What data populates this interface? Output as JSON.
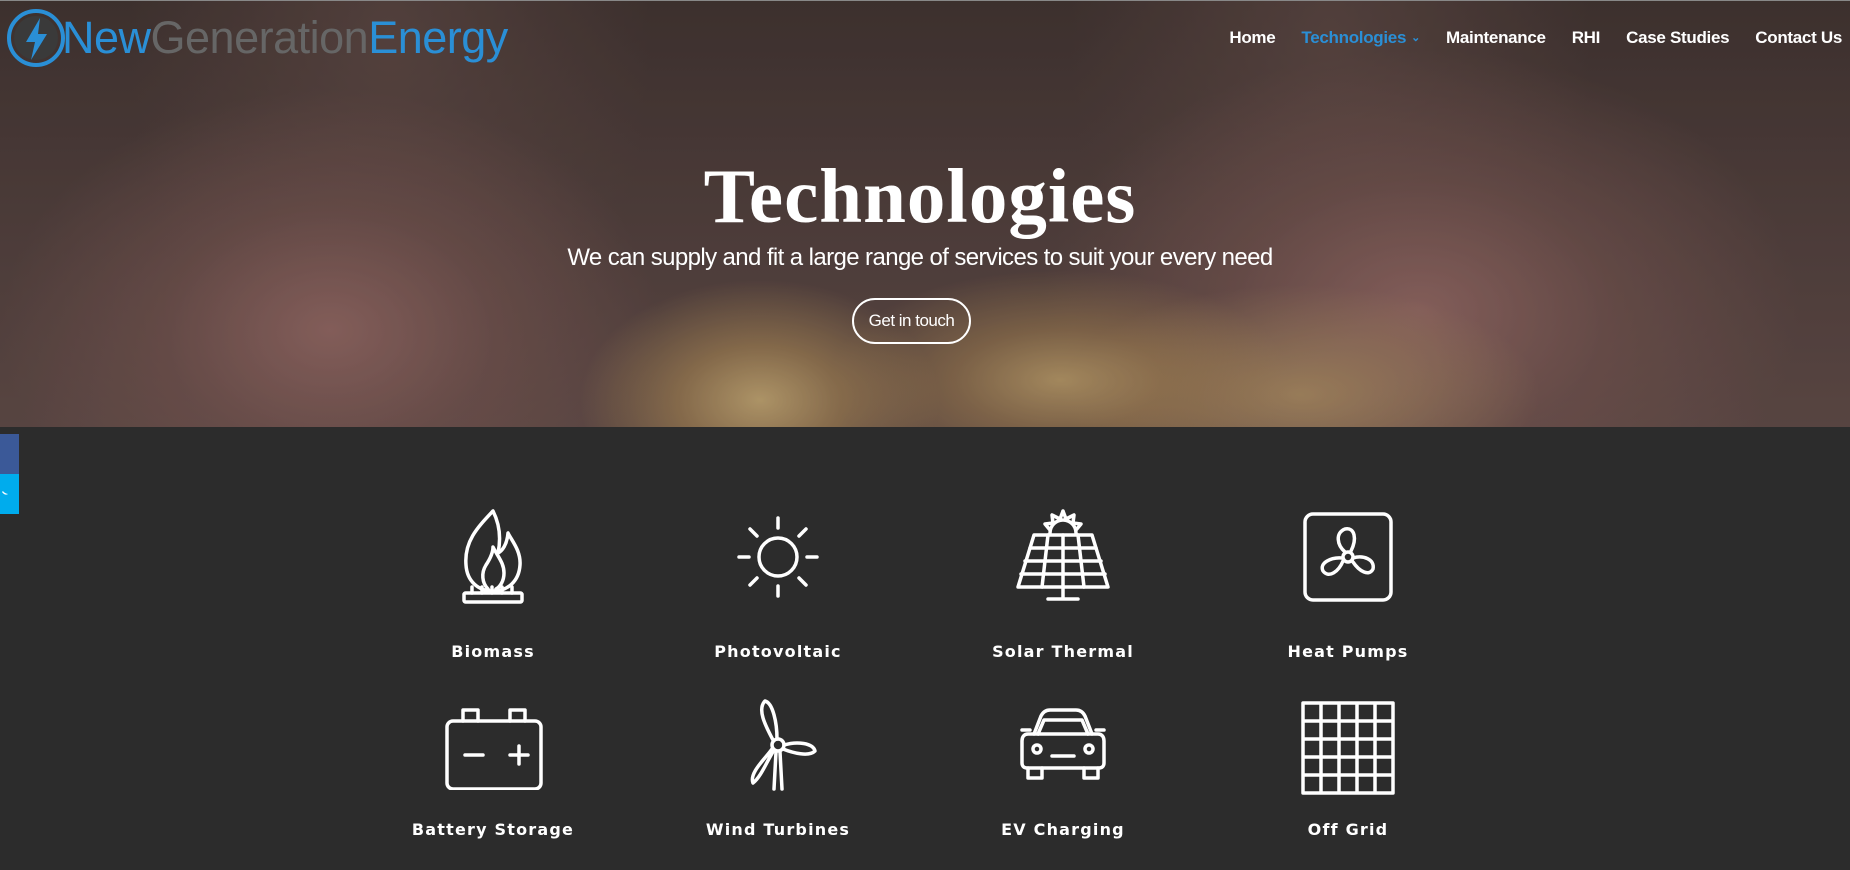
{
  "brand": {
    "name_part1": "New",
    "name_part2": "Generation",
    "name_part3": "Energy",
    "primary_color": "#2a8fd6"
  },
  "nav": {
    "items": [
      {
        "label": "Home",
        "active": false
      },
      {
        "label": "Technologies",
        "active": true,
        "has_dropdown": true
      },
      {
        "label": "Maintenance",
        "active": false
      },
      {
        "label": "RHI",
        "active": false
      },
      {
        "label": "Case Studies",
        "active": false
      },
      {
        "label": "Contact Us",
        "active": false
      }
    ]
  },
  "hero": {
    "title": "Technologies",
    "subtitle": "We can supply and fit a large range of services to suit your every need",
    "button_label": "Get in touch"
  },
  "social": {
    "icons": [
      "facebook-icon",
      "twitter-icon"
    ],
    "colors": [
      "#3b5998",
      "#00aced"
    ]
  },
  "technologies": [
    {
      "label": "Biomass",
      "icon": "flame-icon"
    },
    {
      "label": "Photovoltaic",
      "icon": "sun-icon"
    },
    {
      "label": "Solar Thermal",
      "icon": "solar-panel-icon"
    },
    {
      "label": "Heat Pumps",
      "icon": "fan-icon"
    },
    {
      "label": "Battery Storage",
      "icon": "battery-icon"
    },
    {
      "label": "Wind Turbines",
      "icon": "wind-turbine-icon"
    },
    {
      "label": "EV Charging",
      "icon": "car-icon"
    },
    {
      "label": "Off Grid",
      "icon": "grid-icon"
    }
  ]
}
